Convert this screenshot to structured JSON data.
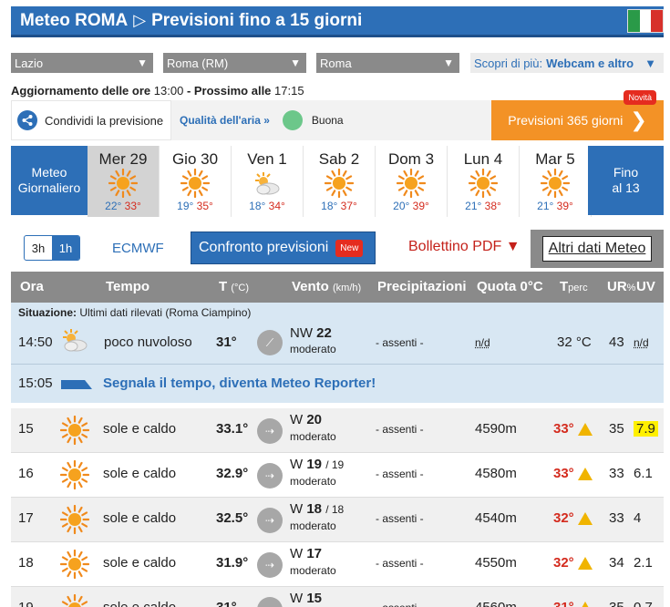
{
  "header": {
    "title": "Meteo ROMA",
    "subtitle": "Previsioni fino a 15 giorni"
  },
  "selectors": {
    "region": "Lazio",
    "province": "Roma (RM)",
    "city": "Roma"
  },
  "scopri": {
    "label": "Scopri di più:",
    "value": "Webcam e altro"
  },
  "update": {
    "label": "Aggiornamento delle ore",
    "time": "13:00",
    "next_label": "- Prossimo alle",
    "next_time": "17:15"
  },
  "share": {
    "label": "Condividi la previsione"
  },
  "air": {
    "label": "Qualità dell'aria »",
    "value": "Buona"
  },
  "prev365": {
    "label": "Previsioni 365 giorni",
    "badge": "Novità"
  },
  "day_strip": {
    "left_button": [
      "Meteo",
      "Giornaliero"
    ],
    "right_button": [
      "Fino",
      "al 13"
    ],
    "days": [
      {
        "label": "Mer 29",
        "min": "22°",
        "max": "33°",
        "icon": "sun-icon"
      },
      {
        "label": "Gio 30",
        "min": "19°",
        "max": "35°",
        "icon": "sun-icon"
      },
      {
        "label": "Ven 1",
        "min": "18°",
        "max": "34°",
        "icon": "partly-cloudy-icon"
      },
      {
        "label": "Sab 2",
        "min": "18°",
        "max": "37°",
        "icon": "sun-icon"
      },
      {
        "label": "Dom 3",
        "min": "20°",
        "max": "39°",
        "icon": "sun-icon"
      },
      {
        "label": "Lun 4",
        "min": "21°",
        "max": "38°",
        "icon": "sun-icon"
      },
      {
        "label": "Mar 5",
        "min": "21°",
        "max": "39°",
        "icon": "sun-icon"
      }
    ]
  },
  "toolbar": {
    "res_3h": "3h",
    "res_1h": "1h",
    "model": "ECMWF",
    "confronto": "Confronto previsioni",
    "new_badge": "New",
    "bollettino": "Bollettino PDF ▼",
    "altri": "Altri dati Meteo"
  },
  "table_headers": {
    "ora": "Ora",
    "tempo": "Tempo",
    "t": "T",
    "t_unit": "(°C)",
    "vento": "Vento",
    "vento_unit": "(km/h)",
    "precip": "Precipitazioni",
    "quota": "Quota 0°C",
    "tperc": "T",
    "tperc_sub": "perc",
    "ur": "UR",
    "ur_unit": "%",
    "uv": "UV"
  },
  "situation": {
    "label": "Situazione:",
    "detail": "Ultimi dati rilevati (Roma Ciampino)",
    "time": "14:50",
    "desc": "poco nuvoloso",
    "temp": "31°",
    "wind_dir": "NW",
    "wind_speed": "22",
    "wind_desc": "moderato",
    "precip": "- assenti -",
    "quota": "n/d",
    "tperc": "32 °C",
    "ur": "43",
    "uv": "n/d"
  },
  "reporter": {
    "time": "15:05",
    "text": "Segnala il tempo, diventa Meteo Reporter!"
  },
  "rows": [
    {
      "hour": "15",
      "desc": "sole e caldo",
      "temp": "33.1°",
      "wind_dir": "W",
      "wind_speed": "20",
      "gust": "",
      "wind_desc": "moderato",
      "precip": "- assenti -",
      "quota": "4590m",
      "tperc": "33°",
      "ur": "35",
      "uv": "7.9"
    },
    {
      "hour": "16",
      "desc": "sole e caldo",
      "temp": "32.9°",
      "wind_dir": "W",
      "wind_speed": "19",
      "gust": "/ 19",
      "wind_desc": "moderato",
      "precip": "- assenti -",
      "quota": "4580m",
      "tperc": "33°",
      "ur": "33",
      "uv": "6.1"
    },
    {
      "hour": "17",
      "desc": "sole e caldo",
      "temp": "32.5°",
      "wind_dir": "W",
      "wind_speed": "18",
      "gust": "/ 18",
      "wind_desc": "moderato",
      "precip": "- assenti -",
      "quota": "4540m",
      "tperc": "32°",
      "ur": "33",
      "uv": "4"
    },
    {
      "hour": "18",
      "desc": "sole e caldo",
      "temp": "31.9°",
      "wind_dir": "W",
      "wind_speed": "17",
      "gust": "",
      "wind_desc": "moderato",
      "precip": "- assenti -",
      "quota": "4550m",
      "tperc": "32°",
      "ur": "34",
      "uv": "2.1"
    },
    {
      "hour": "19",
      "desc": "sole e caldo",
      "temp": "31°",
      "wind_dir": "W",
      "wind_speed": "15",
      "gust": "",
      "wind_desc": "",
      "precip": "- assenti -",
      "quota": "4560m",
      "tperc": "31°",
      "ur": "35",
      "uv": "0.7"
    }
  ],
  "colors": {
    "brand_blue": "#2d6fb7",
    "orange": "#f39226",
    "red": "#d42b1e",
    "situation_bg": "#d8e7f3"
  }
}
